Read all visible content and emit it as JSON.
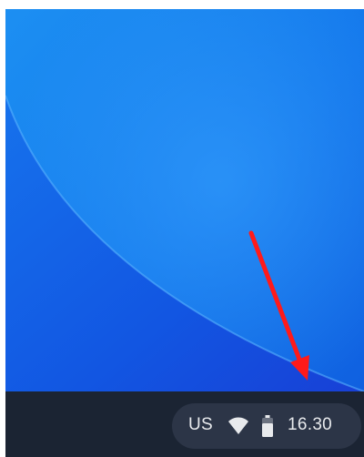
{
  "desktop": {
    "wallpaper_colors": [
      "#1e8cf0",
      "#0f64e3",
      "#1a46d8"
    ]
  },
  "shelf": {
    "background": "#1b2433",
    "status_tray": {
      "locale": "US",
      "wifi_icon": "wifi-icon",
      "battery_icon": "battery-icon",
      "time": "16.30"
    }
  },
  "annotation": {
    "arrow_color": "#ff1a1a",
    "arrow_icon": "arrow-icon"
  }
}
